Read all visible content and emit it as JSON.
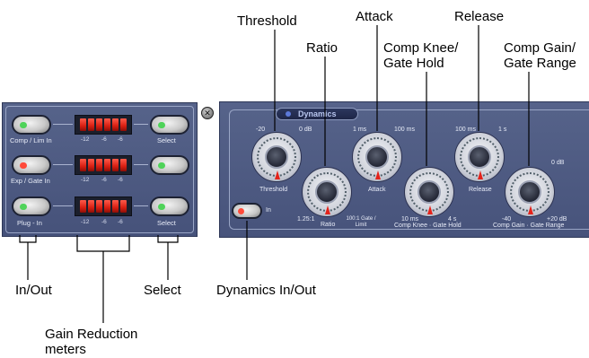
{
  "callouts": {
    "threshold": "Threshold",
    "attack": "Attack",
    "release": "Release",
    "ratio": "Ratio",
    "comp_knee": "Comp Knee/\nGate Hold",
    "comp_gain": "Comp Gain/\nGate Range",
    "in_out": "In/Out",
    "select": "Select",
    "dynamics_in_out": "Dynamics In/Out",
    "gain_reduction": "Gain Reduction\nmeters"
  },
  "left_panel": {
    "rows": [
      {
        "button_label": "Comp / Lim In",
        "select_label": "Select",
        "led_color": "#4fd35a",
        "meter_ticks": [
          "-12",
          "-6",
          "-6"
        ]
      },
      {
        "button_label": "Exp / Gate In",
        "select_label": "Select",
        "led_color": "#ff4a3a",
        "meter_ticks": [
          "-12",
          "-6",
          "-6"
        ]
      },
      {
        "button_label": "Plug - In",
        "select_label": "Select",
        "led_color": "#4fd35a",
        "meter_ticks": [
          "-12",
          "-6",
          "-6"
        ]
      }
    ],
    "close_glyph": "✕"
  },
  "dynamics_panel": {
    "title": "Dynamics",
    "dyn_button_label": "In",
    "dyn_led_color": "#ff4a3a",
    "knobs": {
      "threshold": {
        "label": "Threshold",
        "min": "-20",
        "max": "0 dB"
      },
      "ratio": {
        "label": "Ratio",
        "min": "1.25:1",
        "max": "100:1 Gate / Limit"
      },
      "attack": {
        "label": "Attack",
        "min": "1 ms",
        "max": "100 ms"
      },
      "knee": {
        "label": "Comp Knee · Gate Hold",
        "min": "10 ms",
        "max": "4 s"
      },
      "release": {
        "label": "Release",
        "min": "100 ms",
        "max": "1 s"
      },
      "gain": {
        "label": "Comp Gain · Gate Range",
        "min": "-40",
        "max": "+20 dB",
        "top": "0 dB"
      }
    }
  },
  "colors": {
    "panel": "#4d5980",
    "meter_led": "#e0271a",
    "accent_red": "#e4231b"
  }
}
